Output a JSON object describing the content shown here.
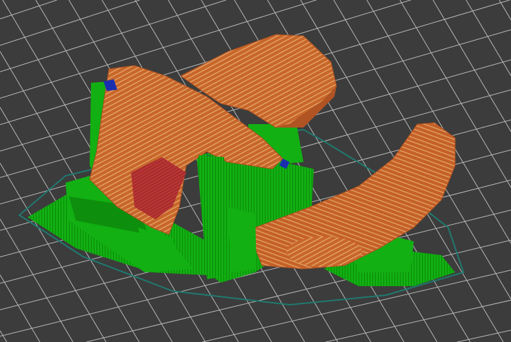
{
  "viewport": {
    "view": "slicer-layer-preview",
    "colors": {
      "background": "#3c3c3c",
      "grid": "#d8d8d8",
      "skirt": "#1f6f66",
      "support": "#12b012",
      "support_dark": "#0a7a0a",
      "perimeter": "#c8662a",
      "perimeter_light": "#e0a060",
      "infill": "#b23030",
      "bridge": "#1a2fb0"
    }
  }
}
